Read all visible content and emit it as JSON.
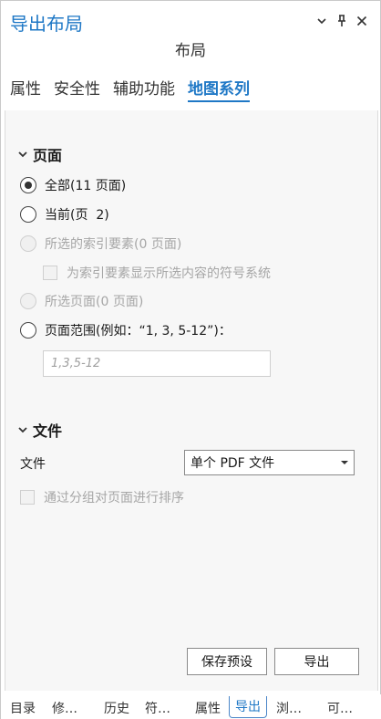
{
  "header": {
    "title": "导出布局",
    "subtitle": "布局"
  },
  "tabs": [
    {
      "label": "属性",
      "active": false
    },
    {
      "label": "安全性",
      "active": false
    },
    {
      "label": "辅助功能",
      "active": false
    },
    {
      "label": "地图系列",
      "active": true
    }
  ],
  "pages_section": {
    "title": "页面",
    "options": [
      {
        "label": "全部(11 页面)",
        "checked": true,
        "disabled": false
      },
      {
        "label": "当前(页  2)",
        "checked": false,
        "disabled": false
      },
      {
        "label": "所选的索引要素(0 页面)",
        "checked": false,
        "disabled": true
      },
      {
        "label": "所选页面(0 页面)",
        "checked": false,
        "disabled": true
      },
      {
        "label": "页面范围(例如：“1, 3, 5-12”)：",
        "checked": false,
        "disabled": false
      }
    ],
    "symbology_checkbox": "为索引要素显示所选内容的符号系统",
    "range_placeholder": "1,3,5-12"
  },
  "file_section": {
    "title": "文件",
    "file_label": "文件",
    "file_value": "单个 PDF 文件",
    "sort_checkbox": "通过分组对页面进行排序"
  },
  "buttons": {
    "save_preset": "保存预设",
    "export": "导出"
  },
  "bottom_tabs": [
    {
      "label": "目录",
      "active": false
    },
    {
      "label": "修…",
      "active": false
    },
    {
      "label": "历史",
      "active": false
    },
    {
      "label": "符…",
      "active": false
    },
    {
      "label": "属性",
      "active": false
    },
    {
      "label": "导出",
      "active": true
    },
    {
      "label": "浏…",
      "active": false
    },
    {
      "label": "可…",
      "active": false
    }
  ],
  "colors": {
    "accent": "#1f78c6",
    "disabled_text": "#a6a6a6"
  }
}
